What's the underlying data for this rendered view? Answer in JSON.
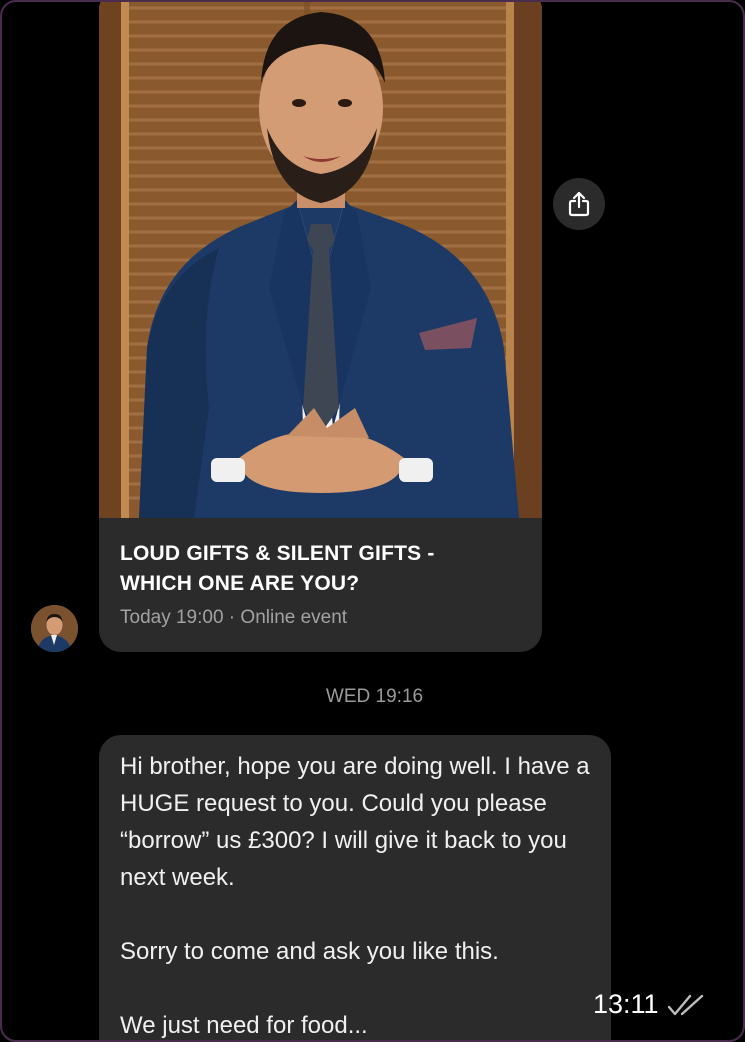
{
  "event": {
    "title_line1": "LOUD GIFTS & SILENT GIFTS -",
    "title_line2": "WHICH ONE ARE YOU?",
    "meta": "Today 19:00 · Online event"
  },
  "date_divider": "WED 19:16",
  "message": {
    "paragraph1": "Hi brother, hope you are doing well. I have a HUGE request to you. Could you please “borrow” us £300? I will give it back to you next week.",
    "paragraph2": "Sorry to come and ask you like this.",
    "paragraph3": "We just need for food...",
    "time": "13:11",
    "status_icon": "double-check-icon"
  },
  "icons": {
    "share": "share-icon",
    "avatar": "avatar"
  },
  "colors": {
    "background": "#000000",
    "bubble": "#2b2b2b",
    "frame": "#4a2c4f"
  }
}
